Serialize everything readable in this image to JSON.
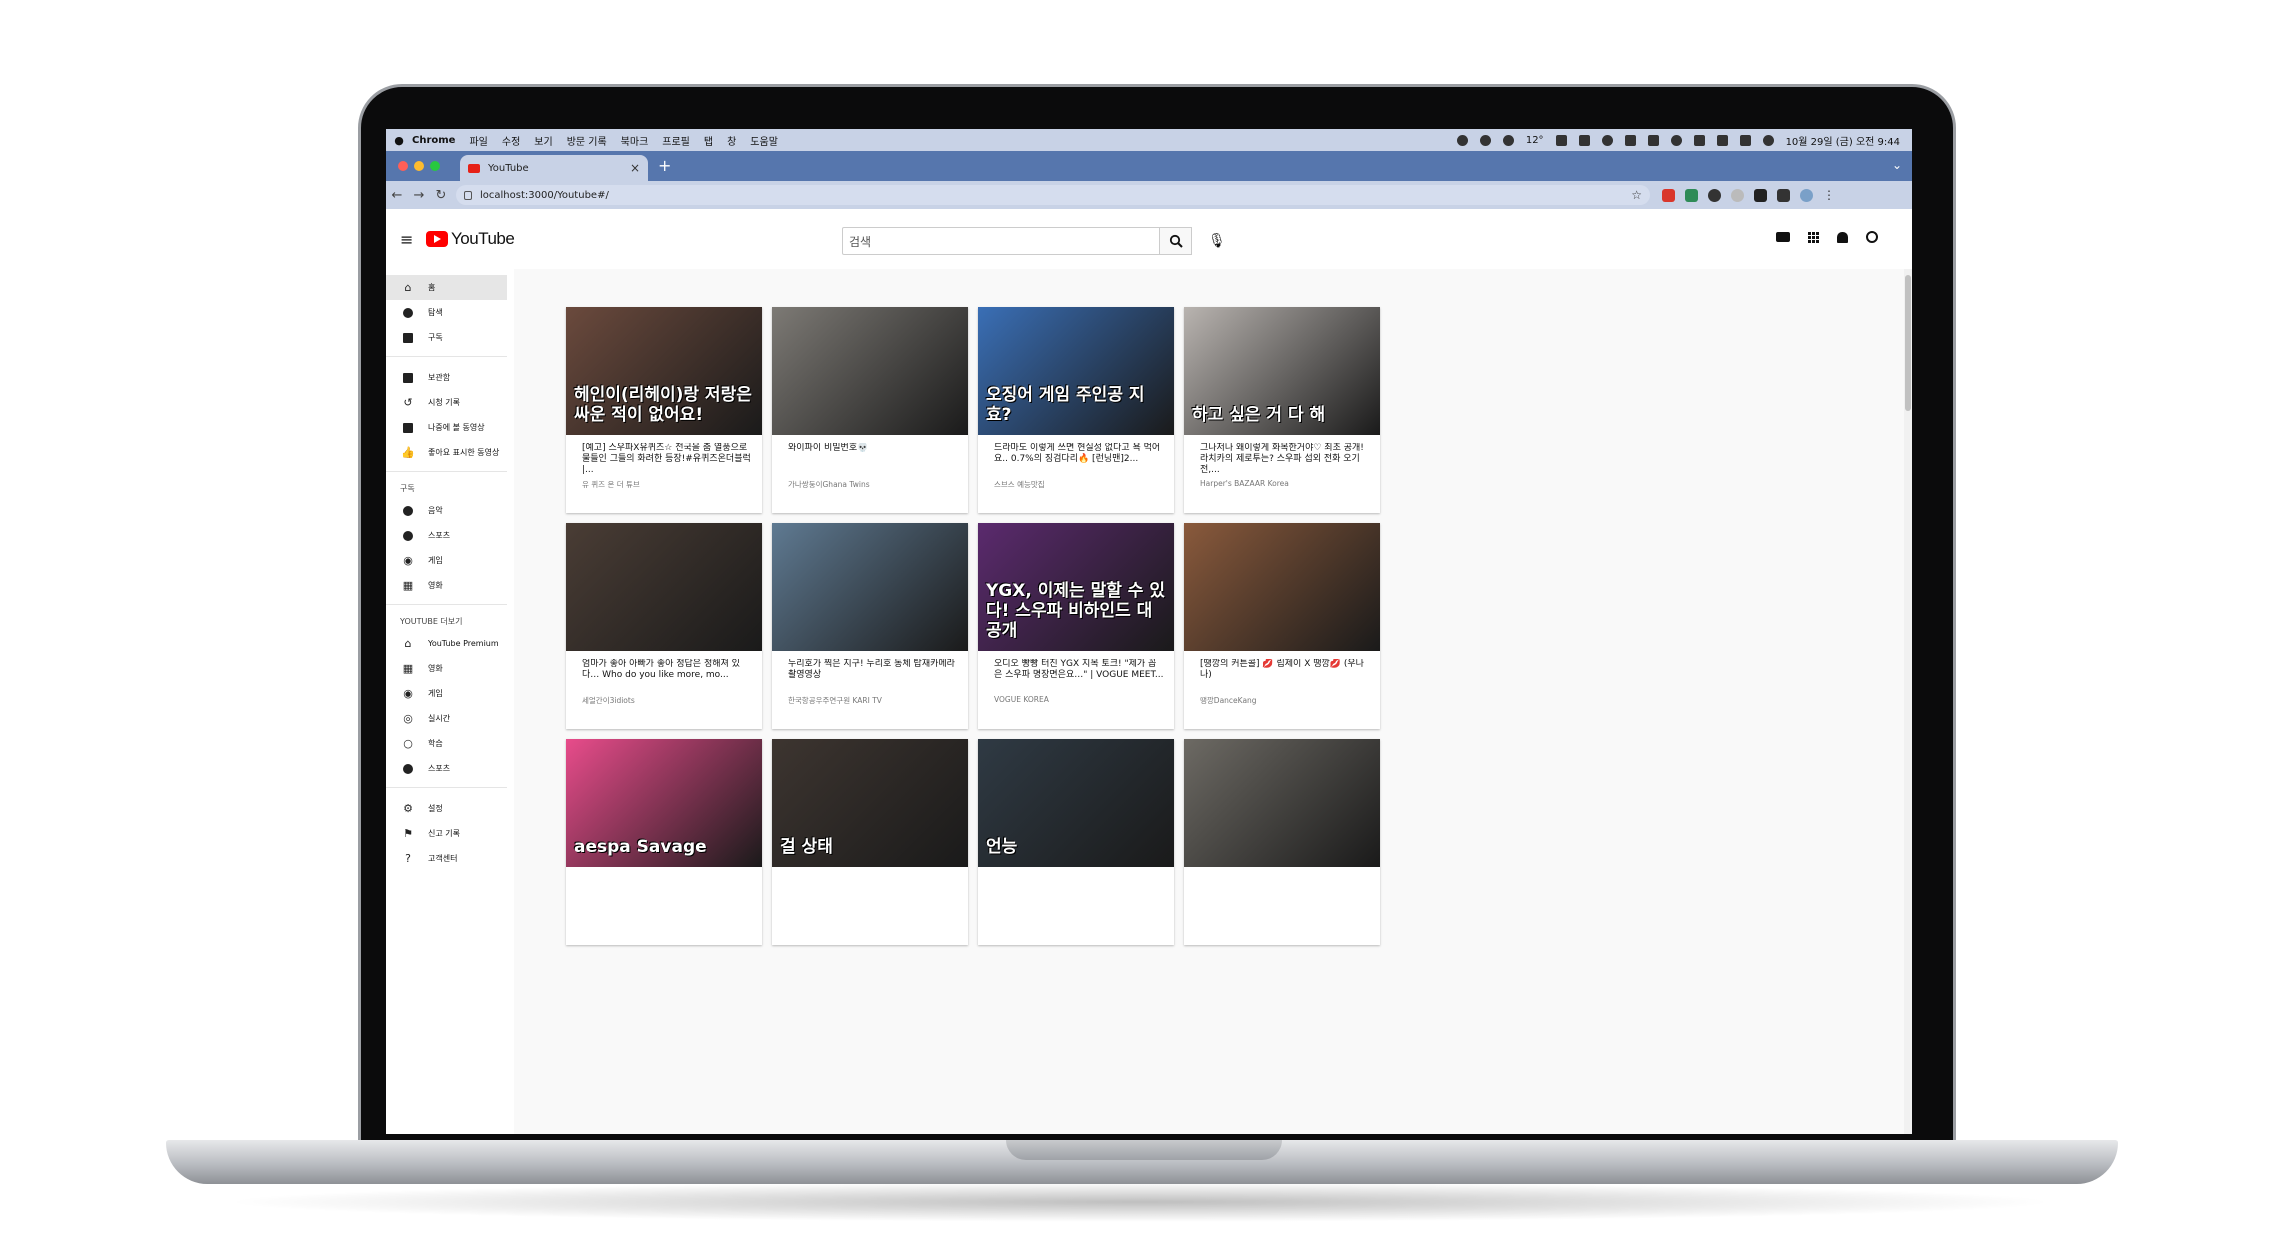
{
  "menubar": {
    "app": "Chrome",
    "items": [
      "파일",
      "수정",
      "보기",
      "방문 기록",
      "북마크",
      "프로필",
      "탭",
      "창",
      "도움말"
    ],
    "weather": "12°",
    "datetime": "10월 29일 (금) 오전 9:44"
  },
  "browser": {
    "tab_title": "YouTube",
    "url": "localhost:3000/Youtube#/"
  },
  "youtube": {
    "logo": "YouTube",
    "search_placeholder": "검색"
  },
  "sidebar": {
    "main": [
      {
        "label": "홈",
        "icon": "home-icon"
      },
      {
        "label": "탐색",
        "icon": "compass-icon"
      },
      {
        "label": "구독",
        "icon": "folder-icon"
      }
    ],
    "library": [
      {
        "label": "보관함",
        "icon": "library-icon"
      },
      {
        "label": "시청 기록",
        "icon": "history-icon"
      },
      {
        "label": "나중에 볼 동영상",
        "icon": "folder-icon"
      },
      {
        "label": "좋아요 표시한 동영상",
        "icon": "thumbs-up-icon"
      }
    ],
    "subscriptions_header": "구독",
    "subscriptions": [
      {
        "label": "음악",
        "icon": "music-icon"
      },
      {
        "label": "스포츠",
        "icon": "sports-icon"
      },
      {
        "label": "게임",
        "icon": "gamepad-icon"
      },
      {
        "label": "영화",
        "icon": "film-icon"
      }
    ],
    "more_header": "YOUTUBE 더보기",
    "more": [
      {
        "label": "YouTube Premium",
        "icon": "youtube-premium-icon"
      },
      {
        "label": "영화",
        "icon": "film-icon"
      },
      {
        "label": "게임",
        "icon": "gamepad-icon"
      },
      {
        "label": "실시간",
        "icon": "live-icon"
      },
      {
        "label": "학습",
        "icon": "lightbulb-icon"
      },
      {
        "label": "스포츠",
        "icon": "sports-icon"
      }
    ],
    "bottom": [
      {
        "label": "설정",
        "icon": "gear-icon"
      },
      {
        "label": "신고 기록",
        "icon": "flag-icon"
      },
      {
        "label": "고객센터",
        "icon": "help-icon"
      }
    ]
  },
  "videos": [
    {
      "title": "[예고] 스우파X유퀴즈☆ 전국을 춤 열풍으로 물들인 그들의 화려한 등장!#유퀴즈온더블럭 |...",
      "channel": "유 퀴즈 온 더 튜브",
      "overlay": "헤인이(리헤이)랑 저랑은 싸운 적이 없어요!",
      "color": "#6b4a3d"
    },
    {
      "title": "와이파이 비밀번호💀",
      "channel": "가나쌍둥이Ghana Twins",
      "overlay": "",
      "color": "#7d7a75"
    },
    {
      "title": "드라마도 이렇게 쓰면 현실성 없다고 욕 먹어요.. 0.7%의 징검다리🔥 [런닝맨]2...",
      "channel": "스브스 예능맛집",
      "overlay": "오징어 게임 주인공 지효?",
      "color": "#3a6fb6"
    },
    {
      "title": "그나저나 왜이렇게 화목한거야♡ 최초 공개! 라치카의 제로투는? 스우파 섭외 전화 오기 전,...",
      "channel": "Harper's BAZAAR Korea",
      "overlay": "하고 싶은 거 다 해",
      "color": "#b9b4b0"
    },
    {
      "title": "엄마가 좋아 아빠가 좋아 정답은 정해져 있다… Who do you like more, mo...",
      "channel": "세얼간이3idiots",
      "overlay": "",
      "color": "#4a3d35"
    },
    {
      "title": "누리호가 찍은 지구! 누리호 동체 탑재카메라 촬영영상",
      "channel": "한국항공우주연구원 KARI TV",
      "overlay": "",
      "color": "#5f7a92"
    },
    {
      "title": "오디오 빵빵 터진 YGX 지목 토크! \"제가 꼽은 스우파 명장면은요…\" | VOGUE MEET...",
      "channel": "VOGUE KOREA",
      "overlay": "YGX, 이제는 말할 수 있다! 스우파 비하인드 대공개",
      "color": "#5b2a6e"
    },
    {
      "title": "[땡깡의 커튼콜] 💋 립제이 X 땡깡💋 (우나나)",
      "channel": "땡깡DanceKang",
      "overlay": "",
      "color": "#8a5a3c"
    },
    {
      "title": "",
      "channel": "",
      "overlay": "aespa Savage",
      "color": "#e84c8b"
    },
    {
      "title": "",
      "channel": "",
      "overlay": "걸 상태",
      "color": "#3d3530"
    },
    {
      "title": "",
      "channel": "",
      "overlay": "언능",
      "color": "#2f3a44"
    },
    {
      "title": "",
      "channel": "",
      "overlay": "",
      "color": "#6d6a64"
    }
  ]
}
